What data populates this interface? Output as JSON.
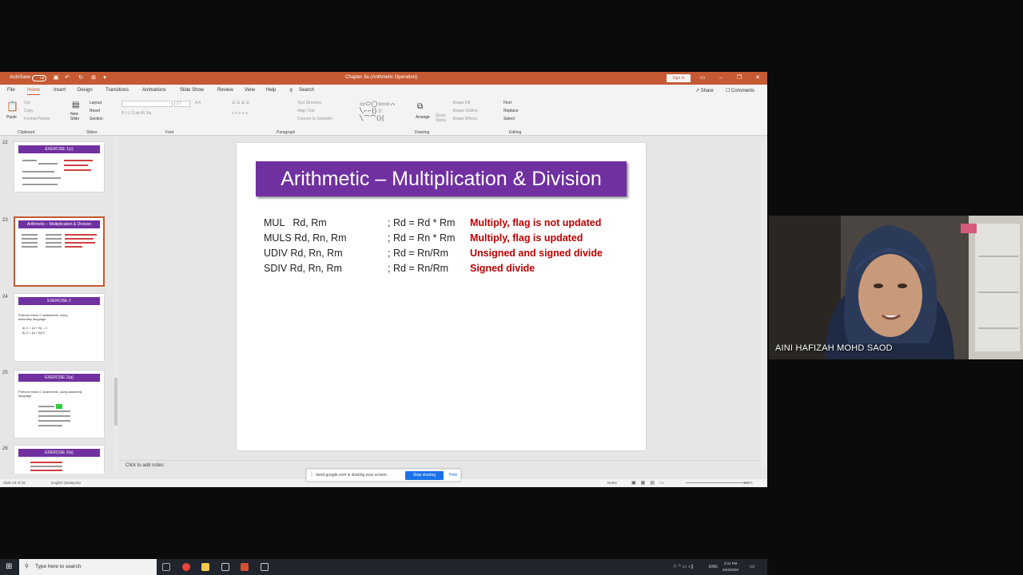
{
  "window": {
    "autosave_label": "AutoSave",
    "autosave_state": "Off",
    "title": "Chapter 3a (Arithmetic Operation)",
    "signin_label": "Sign in"
  },
  "tabs": [
    "File",
    "Home",
    "Insert",
    "Design",
    "Transitions",
    "Animations",
    "Slide Show",
    "Review",
    "View",
    "Help"
  ],
  "active_tab": "Home",
  "search_label": "Search",
  "share_label": "Share",
  "comments_label": "Comments",
  "ribbon": {
    "clipboard": {
      "paste": "Paste",
      "cut": "Cut",
      "copy": "Copy",
      "format_painter": "Format Painter",
      "label": "Clipboard"
    },
    "slides": {
      "new_slide": "New Slide",
      "layout": "Layout",
      "reset": "Reset",
      "section": "Section",
      "label": "Slides"
    },
    "font": {
      "label": "Font",
      "size": "17"
    },
    "paragraph": {
      "text_direction": "Text Direction",
      "align_text": "Align Text",
      "smartart": "Convert to SmartArt",
      "label": "Paragraph"
    },
    "drawing": {
      "arrange": "Arrange",
      "quick_styles": "Quick Styles",
      "shape_fill": "Shape Fill",
      "shape_outline": "Shape Outline",
      "shape_effects": "Shape Effects",
      "label": "Drawing"
    },
    "editing": {
      "find": "Find",
      "replace": "Replace",
      "select": "Select",
      "label": "Editing"
    }
  },
  "thumbnails": [
    {
      "number": "22",
      "title": "EXERCISE 1(c)"
    },
    {
      "number": "23",
      "title": "Arithmetic – Multiplication & Division",
      "selected": true
    },
    {
      "number": "24",
      "title": "EXERCISE 2",
      "body": "Perform these C statements, using assembly language",
      "items": [
        "a) X = (A + B) – C",
        "b) Z = (A + B)*C"
      ]
    },
    {
      "number": "25",
      "title": "EXERCISE 2(a)",
      "body": "Perform these C statements, using assembly language"
    },
    {
      "number": "26",
      "title": "EXERCISE 2(a)"
    }
  ],
  "slide": {
    "title": "Arithmetic – Multiplication & Division",
    "rows": [
      {
        "instr": "MUL   Rd, Rm",
        "op": "; Rd = Rd * Rm",
        "desc": "Multiply, flag is not updated"
      },
      {
        "instr": "MULS Rd, Rn, Rm",
        "op": "; Rd = Rn * Rm",
        "desc": "Multiply, flag is updated"
      },
      {
        "instr": "UDIV Rd, Rn, Rm",
        "op": "; Rd = Rn/Rm",
        "desc": "Unsigned and signed divide"
      },
      {
        "instr": "SDIV Rd, Rn, Rm",
        "op": "; Rd = Rn/Rm",
        "desc": "Signed divide"
      }
    ]
  },
  "notes_placeholder": "Click to add notes",
  "status": {
    "slide_of": "Slide 23 of 28",
    "language": "English (Malaysia)",
    "notes": "Notes",
    "zoom": "108%"
  },
  "sharebar": {
    "message": "meet.google.com is sharing your screen.",
    "stop_label": "Stop sharing",
    "hide_label": "Hide"
  },
  "taskbar": {
    "search_placeholder": "Type here to search",
    "language": "ENG",
    "time": "3:11 PM",
    "date": "30/4/2020"
  },
  "participant": {
    "name": "AINI HAFIZAH MOHD SAOD"
  },
  "colors": {
    "title_bar": "#c55a32",
    "slide_banner": "#7030a0",
    "red_text": "#c00000",
    "meet_blue": "#1a73e8"
  }
}
